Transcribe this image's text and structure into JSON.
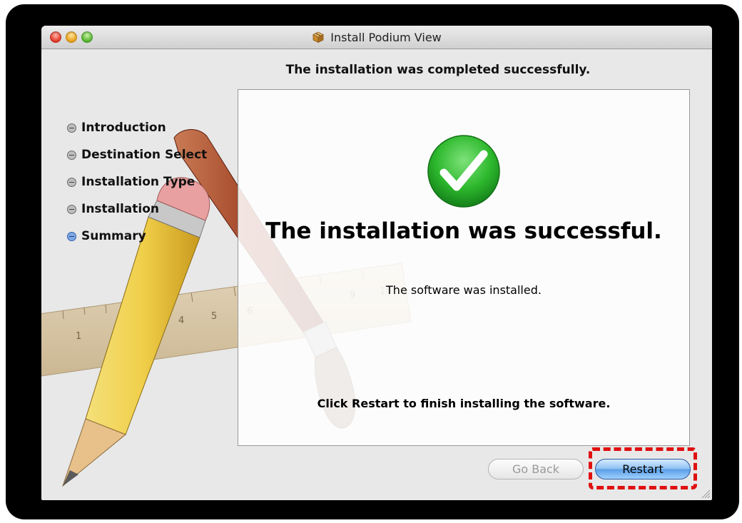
{
  "window": {
    "title": "Install Podium View",
    "title_icon": "package-icon"
  },
  "headline": "The installation was completed successfully.",
  "steps": [
    {
      "label": "Introduction",
      "state": "done"
    },
    {
      "label": "Destination Select",
      "state": "done"
    },
    {
      "label": "Installation Type",
      "state": "done"
    },
    {
      "label": "Installation",
      "state": "done"
    },
    {
      "label": "Summary",
      "state": "current"
    }
  ],
  "content": {
    "status_icon": "checkmark-icon",
    "main_message": "The installation was successful.",
    "sub_message": "The software was installed.",
    "instruction": "Click Restart to finish installing the software."
  },
  "buttons": {
    "go_back": "Go Back",
    "restart": "Restart"
  },
  "ruler_marks": [
    "1",
    "4",
    "5",
    "6",
    "9",
    "10"
  ],
  "colors": {
    "accent_blue": "#5a9fe6",
    "success_green": "#2db82d",
    "highlight_red": "#e01010"
  }
}
